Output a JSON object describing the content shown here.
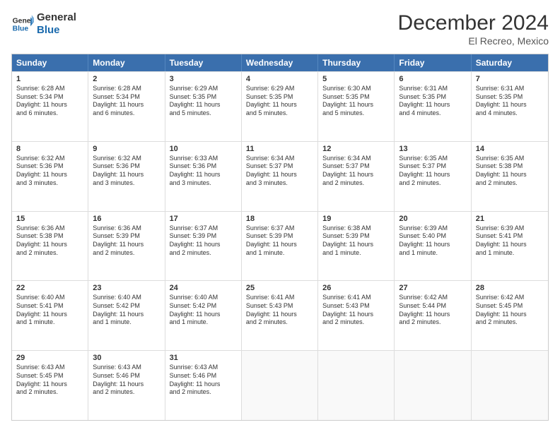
{
  "header": {
    "logo_line1": "General",
    "logo_line2": "Blue",
    "month_title": "December 2024",
    "location": "El Recreo, Mexico"
  },
  "days_of_week": [
    "Sunday",
    "Monday",
    "Tuesday",
    "Wednesday",
    "Thursday",
    "Friday",
    "Saturday"
  ],
  "weeks": [
    [
      {
        "day": 1,
        "sunrise": "6:28 AM",
        "sunset": "5:34 PM",
        "daylight": "11 hours and 6 minutes."
      },
      {
        "day": 2,
        "sunrise": "6:28 AM",
        "sunset": "5:34 PM",
        "daylight": "11 hours and 6 minutes."
      },
      {
        "day": 3,
        "sunrise": "6:29 AM",
        "sunset": "5:35 PM",
        "daylight": "11 hours and 5 minutes."
      },
      {
        "day": 4,
        "sunrise": "6:29 AM",
        "sunset": "5:35 PM",
        "daylight": "11 hours and 5 minutes."
      },
      {
        "day": 5,
        "sunrise": "6:30 AM",
        "sunset": "5:35 PM",
        "daylight": "11 hours and 5 minutes."
      },
      {
        "day": 6,
        "sunrise": "6:31 AM",
        "sunset": "5:35 PM",
        "daylight": "11 hours and 4 minutes."
      },
      {
        "day": 7,
        "sunrise": "6:31 AM",
        "sunset": "5:35 PM",
        "daylight": "11 hours and 4 minutes."
      }
    ],
    [
      {
        "day": 8,
        "sunrise": "6:32 AM",
        "sunset": "5:36 PM",
        "daylight": "11 hours and 3 minutes."
      },
      {
        "day": 9,
        "sunrise": "6:32 AM",
        "sunset": "5:36 PM",
        "daylight": "11 hours and 3 minutes."
      },
      {
        "day": 10,
        "sunrise": "6:33 AM",
        "sunset": "5:36 PM",
        "daylight": "11 hours and 3 minutes."
      },
      {
        "day": 11,
        "sunrise": "6:34 AM",
        "sunset": "5:37 PM",
        "daylight": "11 hours and 3 minutes."
      },
      {
        "day": 12,
        "sunrise": "6:34 AM",
        "sunset": "5:37 PM",
        "daylight": "11 hours and 2 minutes."
      },
      {
        "day": 13,
        "sunrise": "6:35 AM",
        "sunset": "5:37 PM",
        "daylight": "11 hours and 2 minutes."
      },
      {
        "day": 14,
        "sunrise": "6:35 AM",
        "sunset": "5:38 PM",
        "daylight": "11 hours and 2 minutes."
      }
    ],
    [
      {
        "day": 15,
        "sunrise": "6:36 AM",
        "sunset": "5:38 PM",
        "daylight": "11 hours and 2 minutes."
      },
      {
        "day": 16,
        "sunrise": "6:36 AM",
        "sunset": "5:39 PM",
        "daylight": "11 hours and 2 minutes."
      },
      {
        "day": 17,
        "sunrise": "6:37 AM",
        "sunset": "5:39 PM",
        "daylight": "11 hours and 2 minutes."
      },
      {
        "day": 18,
        "sunrise": "6:37 AM",
        "sunset": "5:39 PM",
        "daylight": "11 hours and 1 minute."
      },
      {
        "day": 19,
        "sunrise": "6:38 AM",
        "sunset": "5:39 PM",
        "daylight": "11 hours and 1 minute."
      },
      {
        "day": 20,
        "sunrise": "6:39 AM",
        "sunset": "5:40 PM",
        "daylight": "11 hours and 1 minute."
      },
      {
        "day": 21,
        "sunrise": "6:39 AM",
        "sunset": "5:41 PM",
        "daylight": "11 hours and 1 minute."
      }
    ],
    [
      {
        "day": 22,
        "sunrise": "6:40 AM",
        "sunset": "5:41 PM",
        "daylight": "11 hours and 1 minute."
      },
      {
        "day": 23,
        "sunrise": "6:40 AM",
        "sunset": "5:42 PM",
        "daylight": "11 hours and 1 minute."
      },
      {
        "day": 24,
        "sunrise": "6:40 AM",
        "sunset": "5:42 PM",
        "daylight": "11 hours and 1 minute."
      },
      {
        "day": 25,
        "sunrise": "6:41 AM",
        "sunset": "5:43 PM",
        "daylight": "11 hours and 2 minutes."
      },
      {
        "day": 26,
        "sunrise": "6:41 AM",
        "sunset": "5:43 PM",
        "daylight": "11 hours and 2 minutes."
      },
      {
        "day": 27,
        "sunrise": "6:42 AM",
        "sunset": "5:44 PM",
        "daylight": "11 hours and 2 minutes."
      },
      {
        "day": 28,
        "sunrise": "6:42 AM",
        "sunset": "5:45 PM",
        "daylight": "11 hours and 2 minutes."
      }
    ],
    [
      {
        "day": 29,
        "sunrise": "6:43 AM",
        "sunset": "5:45 PM",
        "daylight": "11 hours and 2 minutes."
      },
      {
        "day": 30,
        "sunrise": "6:43 AM",
        "sunset": "5:46 PM",
        "daylight": "11 hours and 2 minutes."
      },
      {
        "day": 31,
        "sunrise": "6:43 AM",
        "sunset": "5:46 PM",
        "daylight": "11 hours and 2 minutes."
      },
      null,
      null,
      null,
      null
    ]
  ]
}
